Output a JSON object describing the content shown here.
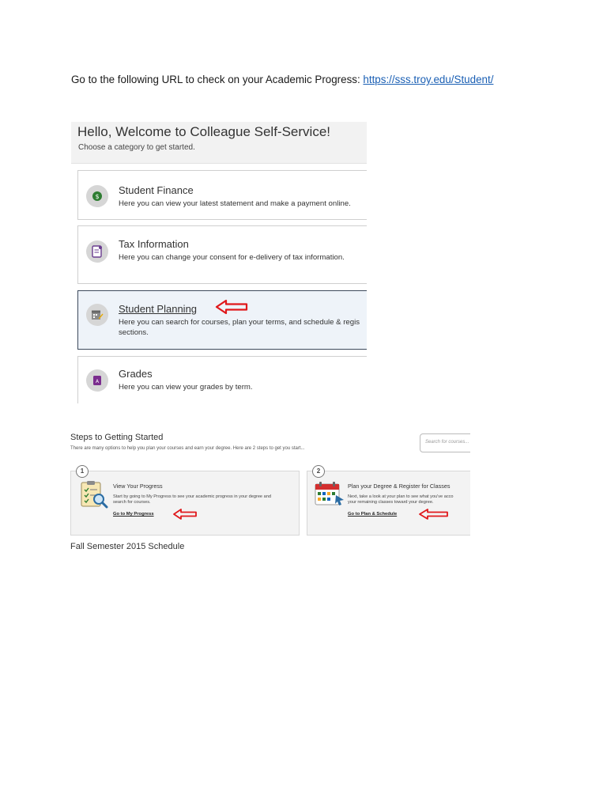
{
  "intro": {
    "text": "Go to the following URL to check on your Academic Progress: ",
    "url": "https://sss.troy.edu/Student/"
  },
  "self_service": {
    "welcome_title": "Hello, Welcome to Colleague Self-Service!",
    "subtitle": "Choose a category to get started.",
    "categories": [
      {
        "title": "Student Finance",
        "description": "Here you can view your latest statement and make a payment online.",
        "icon": "dollar-icon"
      },
      {
        "title": "Tax Information",
        "description": "Here you can change your consent for e-delivery of tax information.",
        "icon": "document-icon"
      },
      {
        "title": "Student Planning",
        "description_line1": "Here you can search for courses, plan your terms, and schedule & regis",
        "description_line2": "sections.",
        "icon": "calendar-edit-icon"
      },
      {
        "title": "Grades",
        "description": "Here you can view your grades by term.",
        "icon": "grades-icon"
      }
    ]
  },
  "steps": {
    "title": "Steps to Getting Started",
    "subtitle": "There are many options to help you plan your courses and earn your degree. Here are 2 steps to get you start...",
    "search_placeholder": "Search for courses...",
    "step1": {
      "number": "1",
      "title": "View Your Progress",
      "desc_line1": "Start by going to My Progress to see your academic progress in your degree and",
      "desc_line2": "search for courses.",
      "link": "Go to My Progress"
    },
    "step2": {
      "number": "2",
      "title": "Plan your Degree & Register for Classes",
      "desc_line1": "Next, take a look at your plan to see what you've acco",
      "desc_line2": "your remaining classes toward your degree.",
      "link": "Go to Plan & Schedule"
    }
  },
  "caption": "Fall Semester 2015 Schedule",
  "colors": {
    "link": "#1a5fb4",
    "arrow": "#e0181b",
    "active_card_bg": "#eef3f9"
  }
}
